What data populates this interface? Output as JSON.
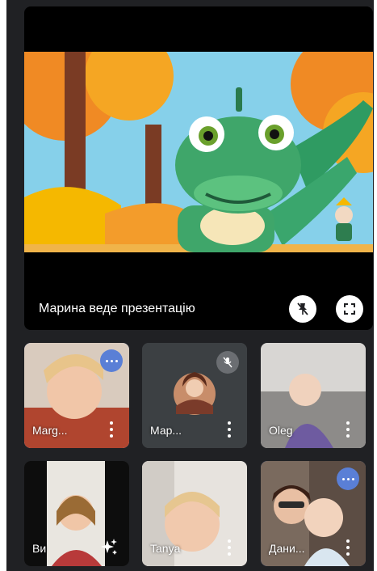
{
  "presentation": {
    "label": "Марина веде презентацію",
    "unpin_icon": "pin-off-icon",
    "fullscreen_icon": "fullscreen-icon"
  },
  "participants": [
    {
      "name": "Marg...",
      "indicator": "speaking-icon"
    },
    {
      "name": "Мар...",
      "indicator": "mic-off-icon"
    },
    {
      "name": "Oleg",
      "indicator": ""
    },
    {
      "name": "Ви",
      "indicator": "visual-effects-icon"
    },
    {
      "name": "Tanya",
      "indicator": ""
    },
    {
      "name": "Дани...",
      "indicator": "speaking-icon"
    }
  ],
  "colors": {
    "background": "#202124",
    "tile": "#3c4043",
    "active_outline": "#2c5fd1",
    "speaking": "#5a7fd6"
  }
}
